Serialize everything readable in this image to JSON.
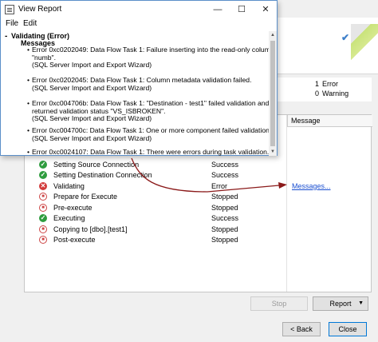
{
  "report_window": {
    "title": "View Report",
    "menu": [
      "File",
      "Edit"
    ],
    "window_controls": [
      "—",
      "☐",
      "✕"
    ],
    "tree_toggle": "-",
    "tree_heading": "Validating (Error)",
    "messages_heading": "Messages",
    "messages": [
      "Error 0xc0202049: Data Flow Task 1: Failure inserting into the read-only column\n\"numb\".\n(SQL Server Import and Export Wizard)",
      "Error 0xc0202045: Data Flow Task 1: Column metadata validation failed.\n(SQL Server Import and Export Wizard)",
      "Error 0xc004706b: Data Flow Task 1: \"Destination - test1\" failed validation and\nreturned validation status \"VS_ISBROKEN\".\n(SQL Server Import and Export Wizard)",
      "Error 0xc004700c: Data Flow Task 1: One or more component failed validation.\n(SQL Server Import and Export Wizard)",
      "Error 0xc0024107: Data Flow Task 1: There were errors during task validation."
    ]
  },
  "wizard": {
    "summary": [
      {
        "count": "1",
        "label": "Error"
      },
      {
        "count": "0",
        "label": "Warning"
      }
    ],
    "grid": {
      "message_header": "Message",
      "rows": [
        {
          "action": "Setting Source Connection",
          "status": "Success",
          "icon": "success",
          "message": ""
        },
        {
          "action": "Setting Destination Connection",
          "status": "Success",
          "icon": "success",
          "message": ""
        },
        {
          "action": "Validating",
          "status": "Error",
          "icon": "error",
          "message": "Messages..."
        },
        {
          "action": "Prepare for Execute",
          "status": "Stopped",
          "icon": "stopped",
          "message": ""
        },
        {
          "action": "Pre-execute",
          "status": "Stopped",
          "icon": "stopped",
          "message": ""
        },
        {
          "action": "Executing",
          "status": "Success",
          "icon": "success",
          "message": ""
        },
        {
          "action": "Copying to [dbo].[test1]",
          "status": "Stopped",
          "icon": "stopped",
          "message": ""
        },
        {
          "action": "Post-execute",
          "status": "Stopped",
          "icon": "stopped",
          "message": ""
        }
      ]
    },
    "buttons": {
      "stop": "Stop",
      "report": "Report",
      "back": "< Back",
      "close": "Close"
    }
  }
}
